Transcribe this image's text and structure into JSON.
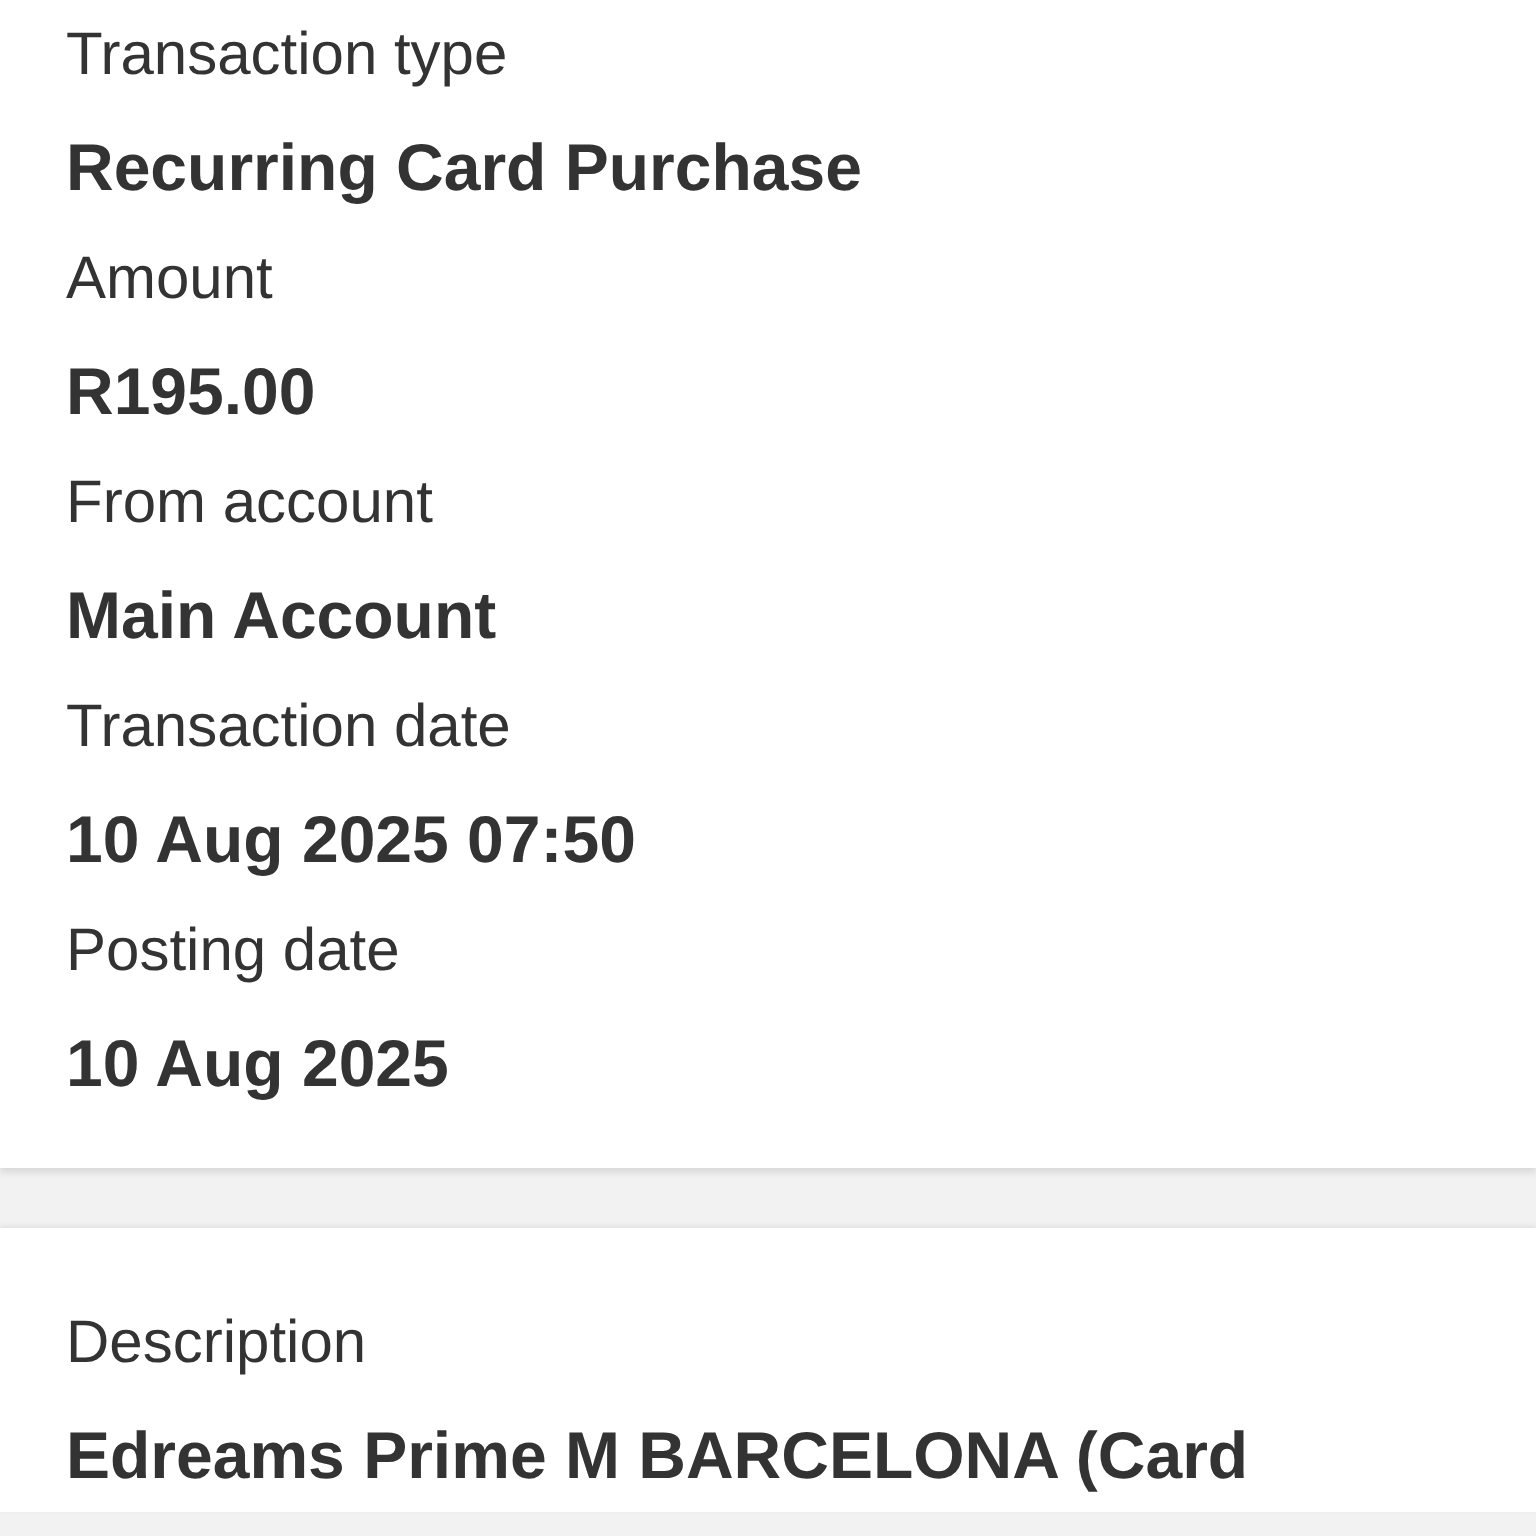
{
  "details": [
    {
      "label": "Transaction type",
      "value": "Recurring Card Purchase"
    },
    {
      "label": "Amount",
      "value": "R195.00"
    },
    {
      "label": "From account",
      "value": "Main Account"
    },
    {
      "label": "Transaction date",
      "value": "10 Aug 2025 07:50"
    },
    {
      "label": "Posting date",
      "value": "10 Aug 2025"
    }
  ],
  "description": {
    "label": "Description",
    "value": "Edreams Prime M BARCELONA (Card"
  }
}
